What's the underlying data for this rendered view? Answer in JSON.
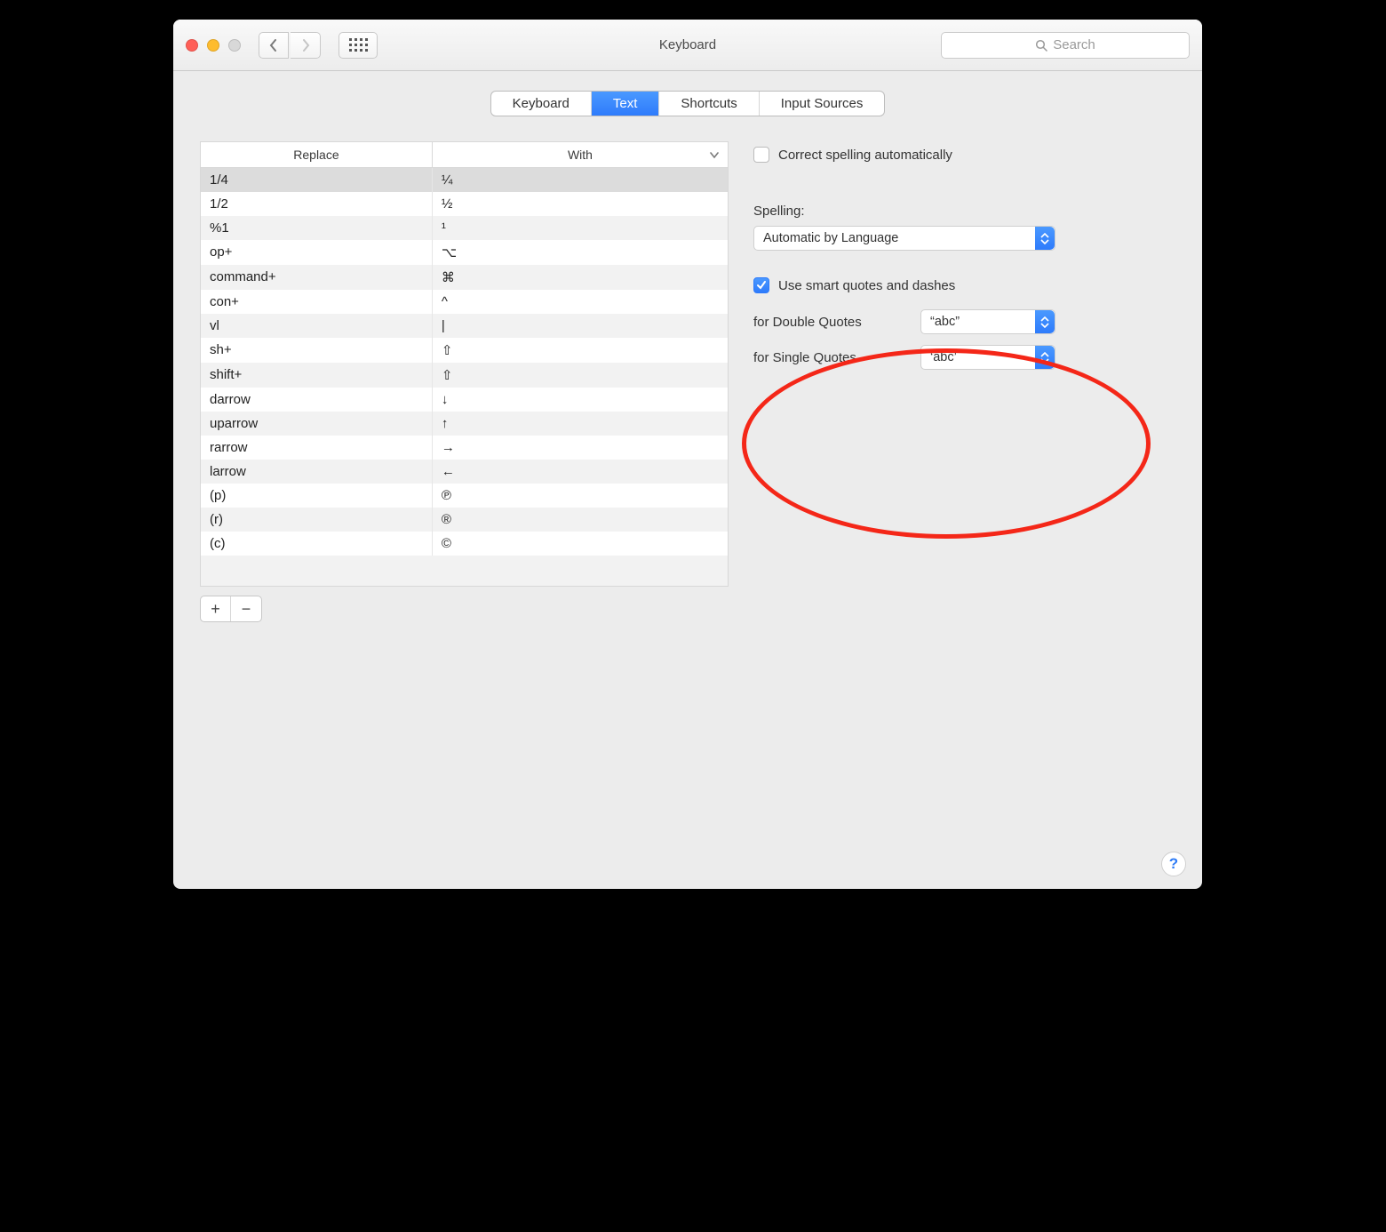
{
  "window": {
    "title": "Keyboard"
  },
  "search": {
    "placeholder": "Search"
  },
  "tabs": [
    {
      "label": "Keyboard",
      "active": false
    },
    {
      "label": "Text",
      "active": true
    },
    {
      "label": "Shortcuts",
      "active": false
    },
    {
      "label": "Input Sources",
      "active": false
    }
  ],
  "table": {
    "headers": {
      "replace": "Replace",
      "with": "With"
    },
    "rows": [
      {
        "replace": "1/4",
        "with": "¼",
        "selected": true
      },
      {
        "replace": "1/2",
        "with": "½"
      },
      {
        "replace": "%1",
        "with": "¹"
      },
      {
        "replace": "op+",
        "with": "⌥"
      },
      {
        "replace": "command+",
        "with": "⌘"
      },
      {
        "replace": "con+",
        "with": "^"
      },
      {
        "replace": "vl",
        "with": "|"
      },
      {
        "replace": "sh+",
        "with": "⇧"
      },
      {
        "replace": "shift+",
        "with": "⇧"
      },
      {
        "replace": "darrow",
        "with": "↓"
      },
      {
        "replace": "uparrow",
        "with": "↑"
      },
      {
        "replace": "rarrow",
        "with": "→"
      },
      {
        "replace": "larrow",
        "with": "←"
      },
      {
        "replace": "(p)",
        "with": "℗"
      },
      {
        "replace": "(r)",
        "with": "®"
      },
      {
        "replace": "(c)",
        "with": "©"
      }
    ],
    "add_label": "+",
    "remove_label": "−"
  },
  "right": {
    "correct_spelling": {
      "checked": false,
      "label": "Correct spelling automatically"
    },
    "spelling_heading": "Spelling:",
    "spelling_select": "Automatic by Language",
    "smart_quotes": {
      "checked": true,
      "label": "Use smart quotes and dashes",
      "double_label": "for Double Quotes",
      "double_value": "“abc”",
      "single_label": "for Single Quotes",
      "single_value": "‘abc’"
    }
  },
  "help_label": "?"
}
